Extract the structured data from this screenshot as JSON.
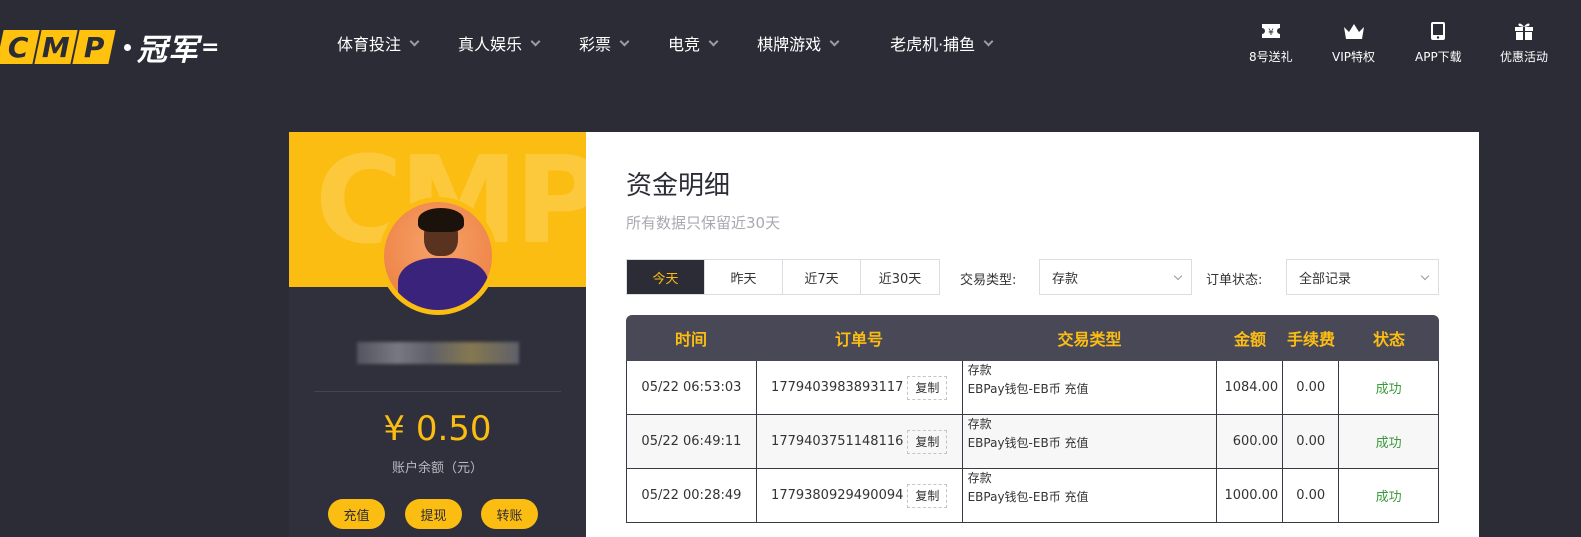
{
  "header": {
    "logo_letters": [
      "C",
      "M",
      "P"
    ],
    "logo_cn": "冠军",
    "nav": [
      {
        "label": "体育投注"
      },
      {
        "label": "真人娱乐"
      },
      {
        "label": "彩票"
      },
      {
        "label": "电竞"
      },
      {
        "label": "棋牌游戏"
      },
      {
        "label": "老虎机·捕鱼"
      }
    ],
    "quick_links": [
      {
        "label": "8号送礼",
        "icon": "ticket-icon"
      },
      {
        "label": "VIP特权",
        "icon": "crown-icon"
      },
      {
        "label": "APP下载",
        "icon": "phone-icon"
      },
      {
        "label": "优惠活动",
        "icon": "gift-icon"
      }
    ]
  },
  "profile": {
    "banner_watermark": "CMP",
    "balance": "¥ 0.50",
    "balance_label": "账户余额（元）",
    "actions": [
      "充值",
      "提现",
      "转账"
    ]
  },
  "main": {
    "title": "资金明细",
    "subtitle": "所有数据只保留近30天",
    "tabs": [
      "今天",
      "昨天",
      "近7天",
      "近30天"
    ],
    "active_tab": "今天",
    "filters": {
      "type_label": "交易类型:",
      "type_value": "存款",
      "status_label": "订单状态:",
      "status_value": "全部记录"
    },
    "table": {
      "columns": [
        "时间",
        "订单号",
        "交易类型",
        "金额",
        "手续费",
        "状态"
      ],
      "copy_label": "复制",
      "rows": [
        {
          "time": "05/22 06:53:03",
          "order": "1779403983893117",
          "type": "存款",
          "type_detail": "EBPay钱包-EB币 充值",
          "amount": "1084.00",
          "fee": "0.00",
          "status": "成功"
        },
        {
          "time": "05/22 06:49:11",
          "order": "1779403751148116",
          "type": "存款",
          "type_detail": "EBPay钱包-EB币 充值",
          "amount": "600.00",
          "fee": "0.00",
          "status": "成功"
        },
        {
          "time": "05/22 00:28:49",
          "order": "1779380929490094",
          "type": "存款",
          "type_detail": "EBPay钱包-EB币 充值",
          "amount": "1000.00",
          "fee": "0.00",
          "status": "成功"
        }
      ]
    }
  },
  "colors": {
    "accent": "#fcbd12",
    "header_bg": "#2b2c36",
    "table_head": "#484857",
    "success": "#3b9b3b"
  }
}
